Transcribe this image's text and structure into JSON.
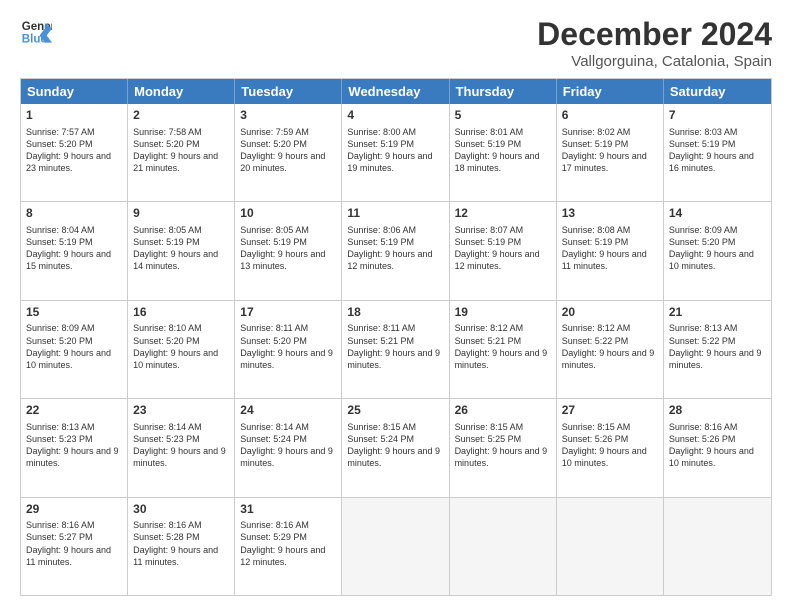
{
  "logo": {
    "line1": "General",
    "line2": "Blue"
  },
  "title": "December 2024",
  "subtitle": "Vallgorguina, Catalonia, Spain",
  "days": [
    "Sunday",
    "Monday",
    "Tuesday",
    "Wednesday",
    "Thursday",
    "Friday",
    "Saturday"
  ],
  "rows": [
    [
      {
        "day": "",
        "empty": true
      },
      {
        "day": "",
        "empty": true
      },
      {
        "day": "",
        "empty": true
      },
      {
        "day": "",
        "empty": true
      },
      {
        "day": "",
        "empty": true
      },
      {
        "day": "",
        "empty": true
      },
      {
        "day": "",
        "empty": true
      }
    ],
    [
      {
        "day": "1",
        "sunrise": "Sunrise: 7:57 AM",
        "sunset": "Sunset: 5:20 PM",
        "daylight": "Daylight: 9 hours and 23 minutes."
      },
      {
        "day": "2",
        "sunrise": "Sunrise: 7:58 AM",
        "sunset": "Sunset: 5:20 PM",
        "daylight": "Daylight: 9 hours and 21 minutes."
      },
      {
        "day": "3",
        "sunrise": "Sunrise: 7:59 AM",
        "sunset": "Sunset: 5:20 PM",
        "daylight": "Daylight: 9 hours and 20 minutes."
      },
      {
        "day": "4",
        "sunrise": "Sunrise: 8:00 AM",
        "sunset": "Sunset: 5:19 PM",
        "daylight": "Daylight: 9 hours and 19 minutes."
      },
      {
        "day": "5",
        "sunrise": "Sunrise: 8:01 AM",
        "sunset": "Sunset: 5:19 PM",
        "daylight": "Daylight: 9 hours and 18 minutes."
      },
      {
        "day": "6",
        "sunrise": "Sunrise: 8:02 AM",
        "sunset": "Sunset: 5:19 PM",
        "daylight": "Daylight: 9 hours and 17 minutes."
      },
      {
        "day": "7",
        "sunrise": "Sunrise: 8:03 AM",
        "sunset": "Sunset: 5:19 PM",
        "daylight": "Daylight: 9 hours and 16 minutes."
      }
    ],
    [
      {
        "day": "8",
        "sunrise": "Sunrise: 8:04 AM",
        "sunset": "Sunset: 5:19 PM",
        "daylight": "Daylight: 9 hours and 15 minutes."
      },
      {
        "day": "9",
        "sunrise": "Sunrise: 8:05 AM",
        "sunset": "Sunset: 5:19 PM",
        "daylight": "Daylight: 9 hours and 14 minutes."
      },
      {
        "day": "10",
        "sunrise": "Sunrise: 8:05 AM",
        "sunset": "Sunset: 5:19 PM",
        "daylight": "Daylight: 9 hours and 13 minutes."
      },
      {
        "day": "11",
        "sunrise": "Sunrise: 8:06 AM",
        "sunset": "Sunset: 5:19 PM",
        "daylight": "Daylight: 9 hours and 12 minutes."
      },
      {
        "day": "12",
        "sunrise": "Sunrise: 8:07 AM",
        "sunset": "Sunset: 5:19 PM",
        "daylight": "Daylight: 9 hours and 12 minutes."
      },
      {
        "day": "13",
        "sunrise": "Sunrise: 8:08 AM",
        "sunset": "Sunset: 5:19 PM",
        "daylight": "Daylight: 9 hours and 11 minutes."
      },
      {
        "day": "14",
        "sunrise": "Sunrise: 8:09 AM",
        "sunset": "Sunset: 5:20 PM",
        "daylight": "Daylight: 9 hours and 10 minutes."
      }
    ],
    [
      {
        "day": "15",
        "sunrise": "Sunrise: 8:09 AM",
        "sunset": "Sunset: 5:20 PM",
        "daylight": "Daylight: 9 hours and 10 minutes."
      },
      {
        "day": "16",
        "sunrise": "Sunrise: 8:10 AM",
        "sunset": "Sunset: 5:20 PM",
        "daylight": "Daylight: 9 hours and 10 minutes."
      },
      {
        "day": "17",
        "sunrise": "Sunrise: 8:11 AM",
        "sunset": "Sunset: 5:20 PM",
        "daylight": "Daylight: 9 hours and 9 minutes."
      },
      {
        "day": "18",
        "sunrise": "Sunrise: 8:11 AM",
        "sunset": "Sunset: 5:21 PM",
        "daylight": "Daylight: 9 hours and 9 minutes."
      },
      {
        "day": "19",
        "sunrise": "Sunrise: 8:12 AM",
        "sunset": "Sunset: 5:21 PM",
        "daylight": "Daylight: 9 hours and 9 minutes."
      },
      {
        "day": "20",
        "sunrise": "Sunrise: 8:12 AM",
        "sunset": "Sunset: 5:22 PM",
        "daylight": "Daylight: 9 hours and 9 minutes."
      },
      {
        "day": "21",
        "sunrise": "Sunrise: 8:13 AM",
        "sunset": "Sunset: 5:22 PM",
        "daylight": "Daylight: 9 hours and 9 minutes."
      }
    ],
    [
      {
        "day": "22",
        "sunrise": "Sunrise: 8:13 AM",
        "sunset": "Sunset: 5:23 PM",
        "daylight": "Daylight: 9 hours and 9 minutes."
      },
      {
        "day": "23",
        "sunrise": "Sunrise: 8:14 AM",
        "sunset": "Sunset: 5:23 PM",
        "daylight": "Daylight: 9 hours and 9 minutes."
      },
      {
        "day": "24",
        "sunrise": "Sunrise: 8:14 AM",
        "sunset": "Sunset: 5:24 PM",
        "daylight": "Daylight: 9 hours and 9 minutes."
      },
      {
        "day": "25",
        "sunrise": "Sunrise: 8:15 AM",
        "sunset": "Sunset: 5:24 PM",
        "daylight": "Daylight: 9 hours and 9 minutes."
      },
      {
        "day": "26",
        "sunrise": "Sunrise: 8:15 AM",
        "sunset": "Sunset: 5:25 PM",
        "daylight": "Daylight: 9 hours and 9 minutes."
      },
      {
        "day": "27",
        "sunrise": "Sunrise: 8:15 AM",
        "sunset": "Sunset: 5:26 PM",
        "daylight": "Daylight: 9 hours and 10 minutes."
      },
      {
        "day": "28",
        "sunrise": "Sunrise: 8:16 AM",
        "sunset": "Sunset: 5:26 PM",
        "daylight": "Daylight: 9 hours and 10 minutes."
      }
    ],
    [
      {
        "day": "29",
        "sunrise": "Sunrise: 8:16 AM",
        "sunset": "Sunset: 5:27 PM",
        "daylight": "Daylight: 9 hours and 11 minutes."
      },
      {
        "day": "30",
        "sunrise": "Sunrise: 8:16 AM",
        "sunset": "Sunset: 5:28 PM",
        "daylight": "Daylight: 9 hours and 11 minutes."
      },
      {
        "day": "31",
        "sunrise": "Sunrise: 8:16 AM",
        "sunset": "Sunset: 5:29 PM",
        "daylight": "Daylight: 9 hours and 12 minutes."
      },
      {
        "day": "",
        "empty": true
      },
      {
        "day": "",
        "empty": true
      },
      {
        "day": "",
        "empty": true
      },
      {
        "day": "",
        "empty": true
      }
    ]
  ]
}
